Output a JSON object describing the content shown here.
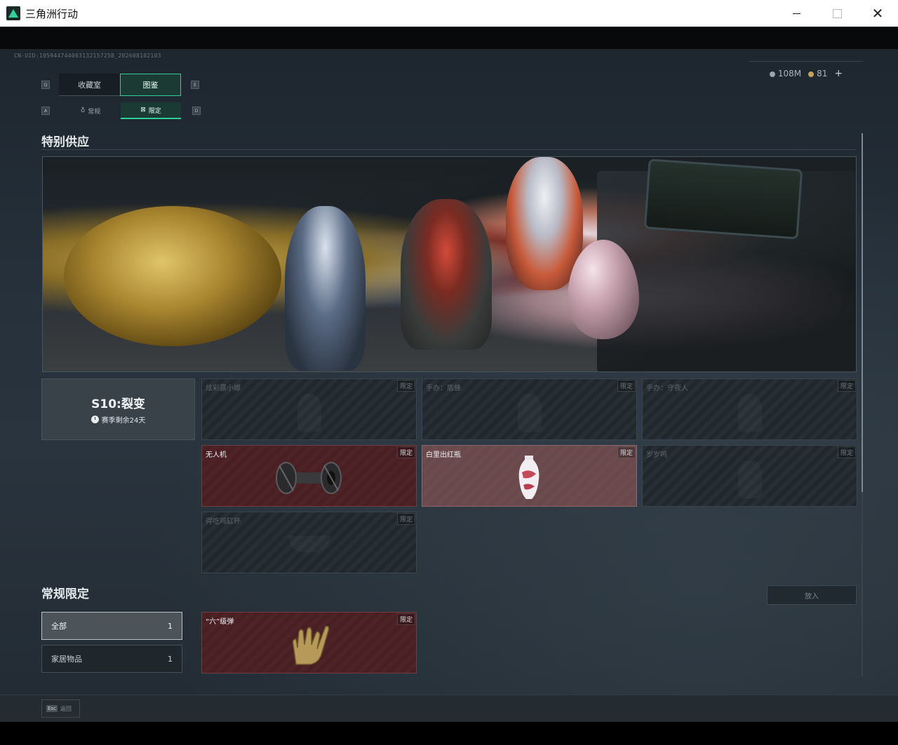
{
  "window": {
    "title": "三角洲行动",
    "minimize_icon": "minimize-icon",
    "maximize_icon": "maximize-icon",
    "close_glyph": "✕"
  },
  "header": {
    "uid": "CN-UID:10594474400313215725B_202608102103",
    "currency_silver": "108M",
    "currency_gold": "81",
    "plus": "+"
  },
  "keys": {
    "q": "Q",
    "e": "E",
    "a": "A",
    "d": "D"
  },
  "tabs_main": [
    {
      "label": "收藏室",
      "active": false
    },
    {
      "label": "图鉴",
      "active": true
    }
  ],
  "tabs_sub": [
    {
      "label": "常规",
      "glyph": "♁",
      "active": false
    },
    {
      "label": "限定",
      "glyph": "⊠",
      "active": true
    }
  ],
  "special": {
    "title": "特别供应",
    "season_title": "S10:裂变",
    "season_remaining": "赛季剩余24天",
    "cards": [
      {
        "name": "炫彩露小娜",
        "badge": "限定",
        "style": "dim"
      },
      {
        "name": "手办：盾蜂",
        "badge": "限定",
        "style": "dim"
      },
      {
        "name": "手办：守夜人",
        "badge": "限定",
        "style": "dim"
      },
      {
        "name": "无人机",
        "badge": "限定",
        "style": "red",
        "icon": "drone-icon"
      },
      {
        "name": "白里出红瓶",
        "badge": "限定",
        "style": "pink",
        "icon": "vase-icon"
      },
      {
        "name": "岁岁鸣",
        "badge": "限定",
        "style": "dim"
      },
      {
        "name": "得吃鸡缸杯",
        "badge": "限定",
        "style": "dim"
      }
    ]
  },
  "regular": {
    "title": "常规限定",
    "filters": [
      {
        "label": "全部",
        "count": "1",
        "active": true
      },
      {
        "label": "家居物品",
        "count": "1",
        "active": false
      }
    ],
    "place_button": "放入",
    "cards": [
      {
        "name": "“六”级弹",
        "badge": "限定",
        "style": "red",
        "icon": "glove-icon"
      }
    ]
  },
  "footer": {
    "esc_key": "Esc",
    "esc_label": "返回"
  },
  "colors": {
    "accent": "#2fcf98",
    "limited_red": "#4a1f24",
    "limited_pink": "#6a484c"
  }
}
